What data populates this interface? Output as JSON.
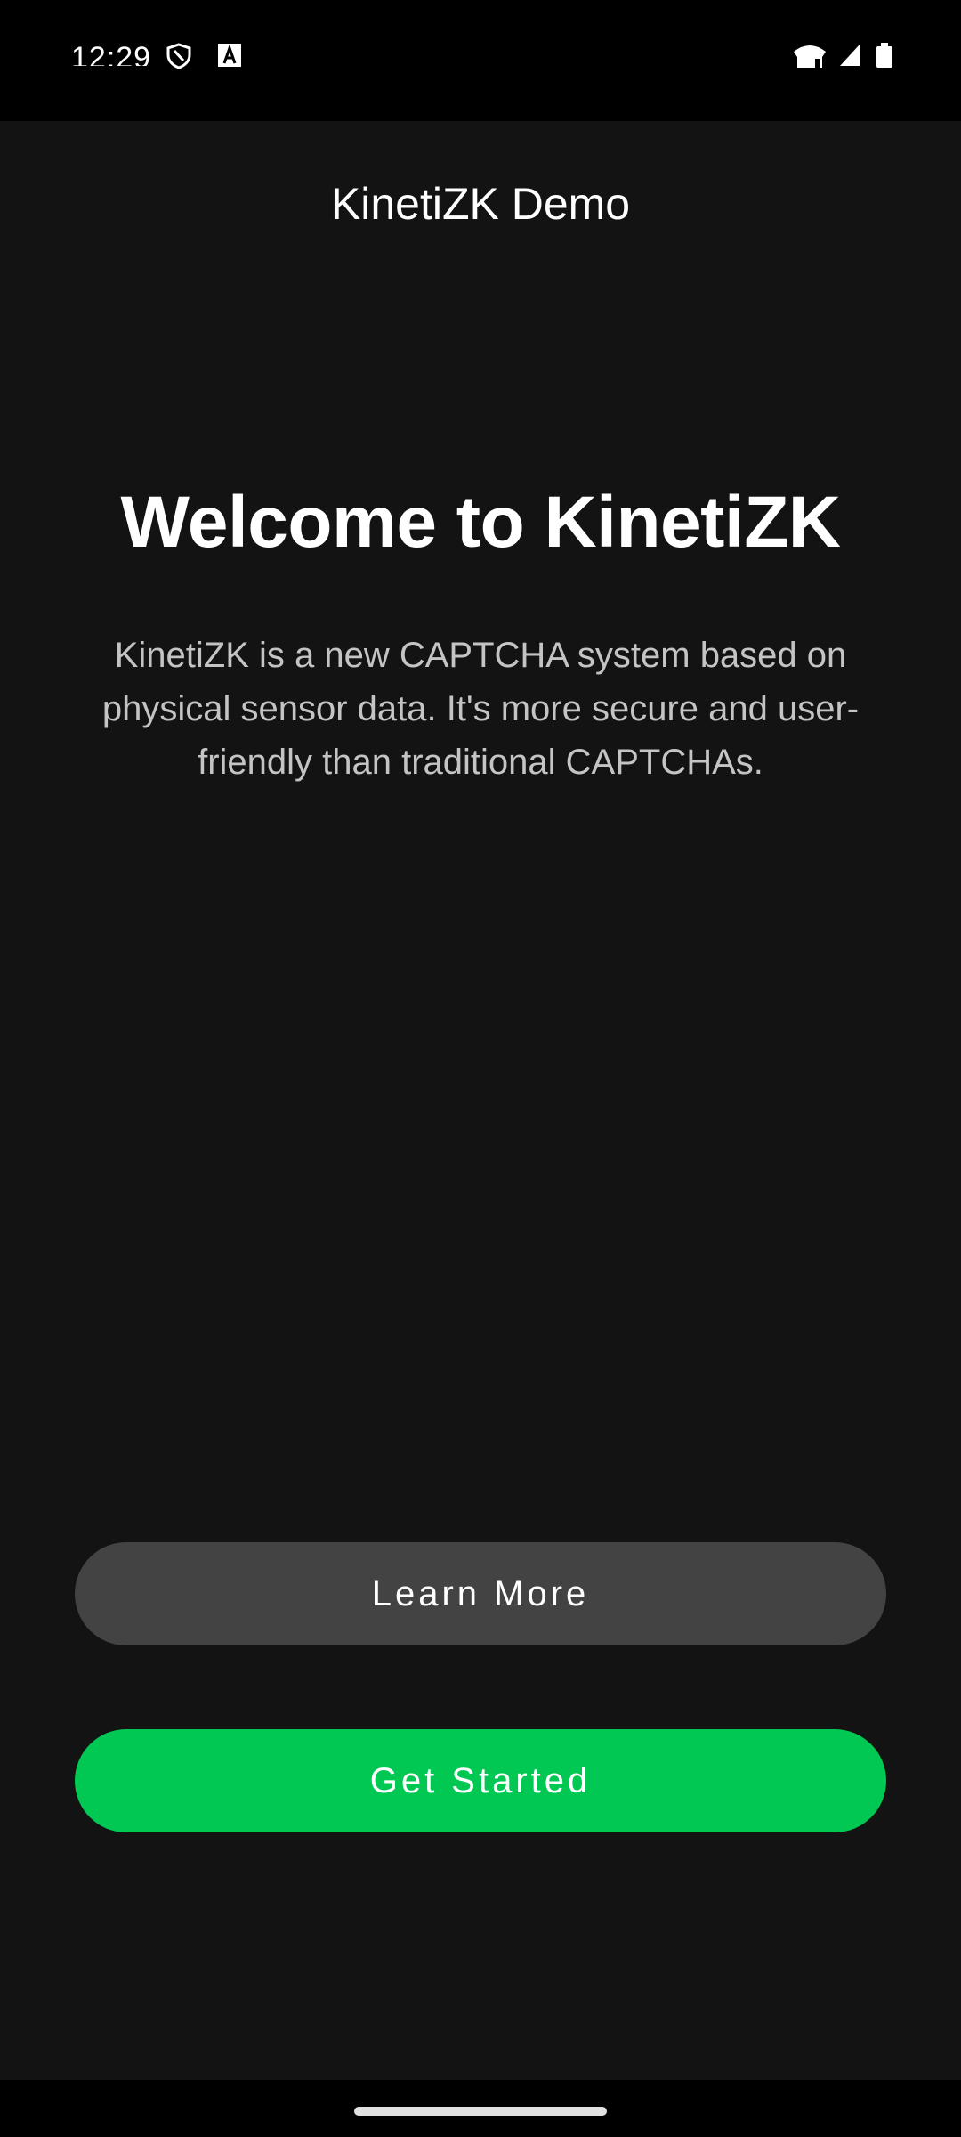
{
  "status_bar": {
    "time": "12:29",
    "icons": [
      "shield-icon",
      "accessibility-a-icon",
      "wifi-icon",
      "signal-icon",
      "battery-icon"
    ]
  },
  "app": {
    "title": "KinetiZK Demo",
    "headline": "Welcome to KinetiZK",
    "description": "KinetiZK is a new CAPTCHA system based on physical sensor data. It's more secure and user-friendly than traditional CAPTCHAs.",
    "buttons": {
      "learn_more": "Learn More",
      "get_started": "Get Started"
    },
    "colors": {
      "background": "#131313",
      "primary": "#00c853",
      "secondary": "#434343",
      "body_text": "#c4c4c4"
    }
  }
}
